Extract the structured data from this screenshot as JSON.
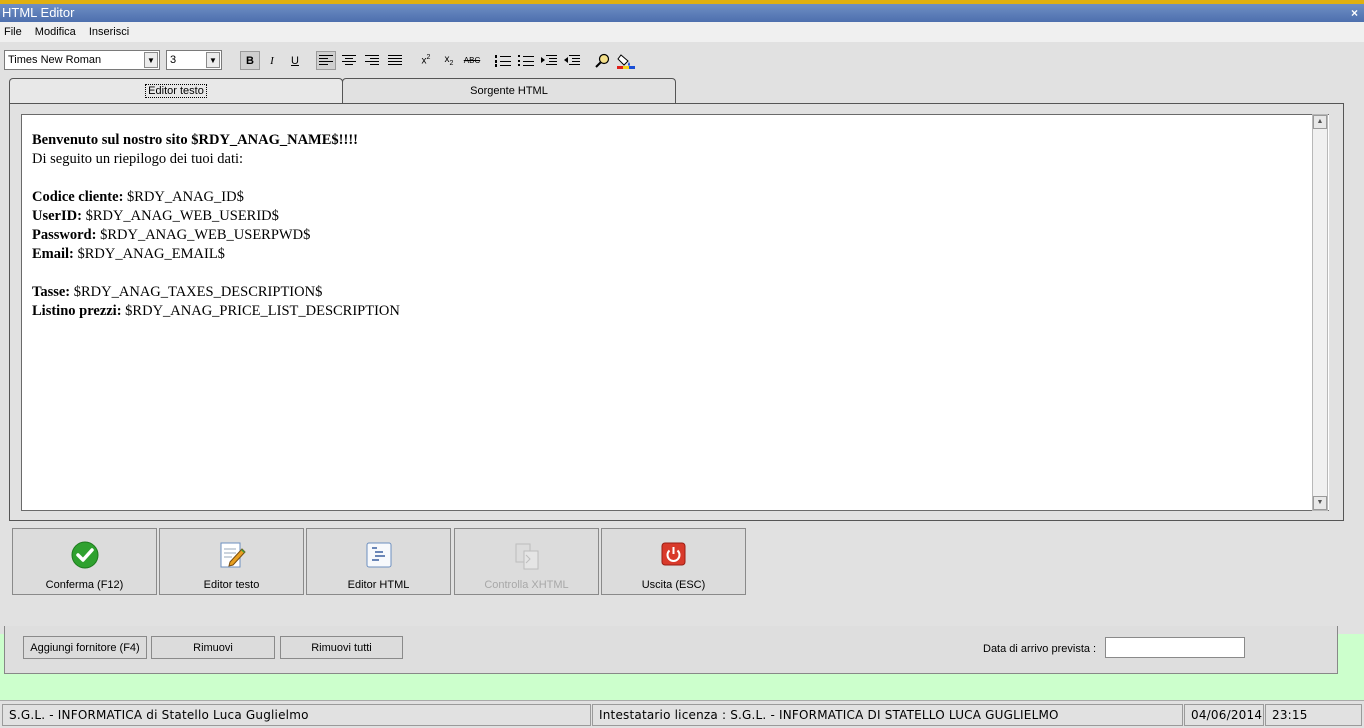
{
  "window": {
    "title": "HTML Editor",
    "close_glyph": "×"
  },
  "menu": [
    "File",
    "Modifica",
    "Inserisci"
  ],
  "toolbar": {
    "font_name": "Times New Roman",
    "font_size": "3",
    "bold": "B",
    "italic": "I",
    "underline": "U",
    "strike_label": "ABC"
  },
  "tabs": [
    {
      "label": "Editor testo",
      "active": true
    },
    {
      "label": "Sorgente HTML",
      "active": false
    }
  ],
  "editor": {
    "line1_bold": "Benvenuto sul nostro sito $RDY_ANAG_NAME$!!!!",
    "line2": "Di seguito un riepilogo dei tuoi dati:",
    "fields": [
      {
        "label": "Codice cliente:",
        "value": " $RDY_ANAG_ID$"
      },
      {
        "label": "UserID:",
        "value": " $RDY_ANAG_WEB_USERID$"
      },
      {
        "label": "Password:",
        "value": " $RDY_ANAG_WEB_USERPWD$"
      },
      {
        "label": "Email:",
        "value": " $RDY_ANAG_EMAIL$"
      }
    ],
    "fields2": [
      {
        "label": "Tasse:",
        "value": " $RDY_ANAG_TAXES_DESCRIPTION$"
      },
      {
        "label": "Listino prezzi:",
        "value": " $RDY_ANAG_PRICE_LIST_DESCRIPTION"
      }
    ]
  },
  "buttons": {
    "confirm": "Conferma (F12)",
    "text_editor": "Editor testo",
    "html_editor": "Editor HTML",
    "check_xhtml": "Controlla XHTML",
    "exit": "Uscita (ESC)"
  },
  "background_form": {
    "add_supplier": "Aggiungi fornitore (F4)",
    "remove": "Rimuovi",
    "remove_all": "Rimuovi tutti",
    "arrival_label": "Data di arrivo prevista :",
    "arrival_value": ""
  },
  "status": {
    "company": "S.G.L. - INFORMATICA di Statello Luca Guglielmo",
    "license": "Intestatario licenza : S.G.L. - INFORMATICA DI STATELLO LUCA GUGLIELMO",
    "date": "04/06/2014",
    "time": "23:15"
  },
  "colors": {
    "title_bar": "#4d6fae",
    "confirm_green": "#2fa12f",
    "exit_red": "#d93a2b",
    "background_form": "#ccffcc"
  }
}
